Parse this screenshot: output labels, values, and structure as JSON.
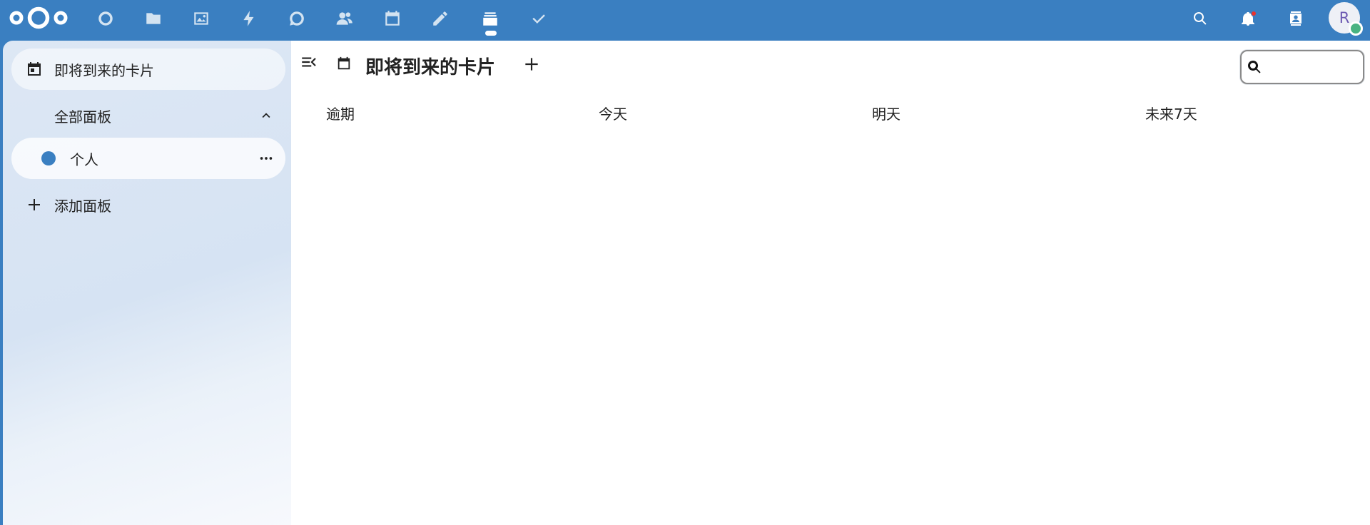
{
  "header": {
    "apps": [
      {
        "name": "dashboard",
        "icon": "dashboard-icon"
      },
      {
        "name": "files",
        "icon": "folder-icon"
      },
      {
        "name": "photos",
        "icon": "image-icon"
      },
      {
        "name": "activity",
        "icon": "lightning-icon"
      },
      {
        "name": "talk",
        "icon": "chat-icon"
      },
      {
        "name": "contacts",
        "icon": "people-icon"
      },
      {
        "name": "calendar",
        "icon": "calendar-icon"
      },
      {
        "name": "notes",
        "icon": "pencil-icon"
      },
      {
        "name": "deck",
        "icon": "deck-icon",
        "active": true
      },
      {
        "name": "tasks",
        "icon": "checkmark-icon"
      }
    ],
    "right_icons": [
      "search-icon",
      "bell-icon",
      "contacts-menu-icon"
    ],
    "avatar_initial": "R",
    "user_status": "online"
  },
  "sidebar": {
    "items": [
      {
        "label": "即将到来的卡片",
        "icon": "calendar-icon",
        "active": true
      },
      {
        "label": "全部面板",
        "icon": "chevron-up-icon",
        "expanded": true
      },
      {
        "label": "个人",
        "color": "#3a7fc1"
      },
      {
        "label": "添加面板",
        "icon": "plus-icon"
      }
    ]
  },
  "main": {
    "title": "即将到来的卡片",
    "search": {
      "value": "",
      "placeholder": ""
    },
    "columns": [
      "逾期",
      "今天",
      "明天",
      "未来7天"
    ]
  },
  "colors": {
    "brand": "#3a7fc1",
    "background": "#ffffff",
    "status_online": "#49b382",
    "notification": "#e9322d"
  }
}
